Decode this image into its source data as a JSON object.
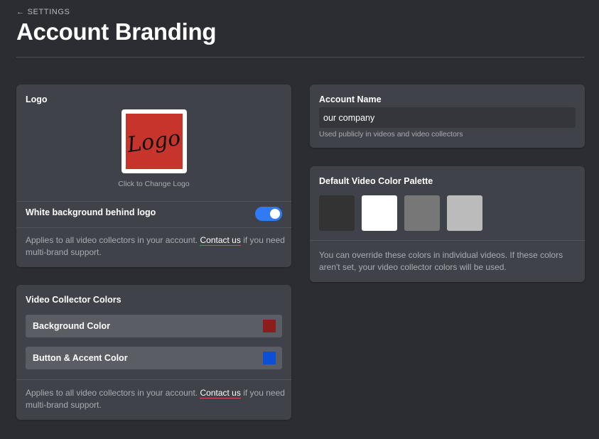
{
  "header": {
    "back_label": "SETTINGS",
    "title": "Account Branding"
  },
  "logo_card": {
    "title": "Logo",
    "logo_text": "Logo",
    "change_logo_label": "Click to Change Logo",
    "toggle_label": "White background behind logo",
    "toggle_on": true,
    "hint_before": "Applies to all video collectors in your account.",
    "hint_link": "Contact us",
    "hint_after": "if you need multi-brand support."
  },
  "collector_card": {
    "title": "Video Collector Colors",
    "rows": [
      {
        "label": "Background Color",
        "color": "#8c1d1d"
      },
      {
        "label": "Button & Accent Color",
        "color": "#0b4fd6"
      }
    ],
    "hint_before": "Applies to all video collectors in your account.",
    "hint_link": "Contact us",
    "hint_after": "if you need multi-brand support."
  },
  "account_card": {
    "title": "Account Name",
    "value": "our company",
    "hint": "Used publicly in videos and video collectors"
  },
  "palette_card": {
    "title": "Default Video Color Palette",
    "swatches": [
      "#333333",
      "#ffffff",
      "#777777",
      "#bbbbbb"
    ],
    "hint": "You can override these colors in individual videos. If these colors aren't set, your video collector colors will be used."
  },
  "colors": {
    "background": "#2b2d33",
    "card": "#404249",
    "accent_toggle": "#2f7bf5",
    "link_underline": "#d9475c"
  }
}
